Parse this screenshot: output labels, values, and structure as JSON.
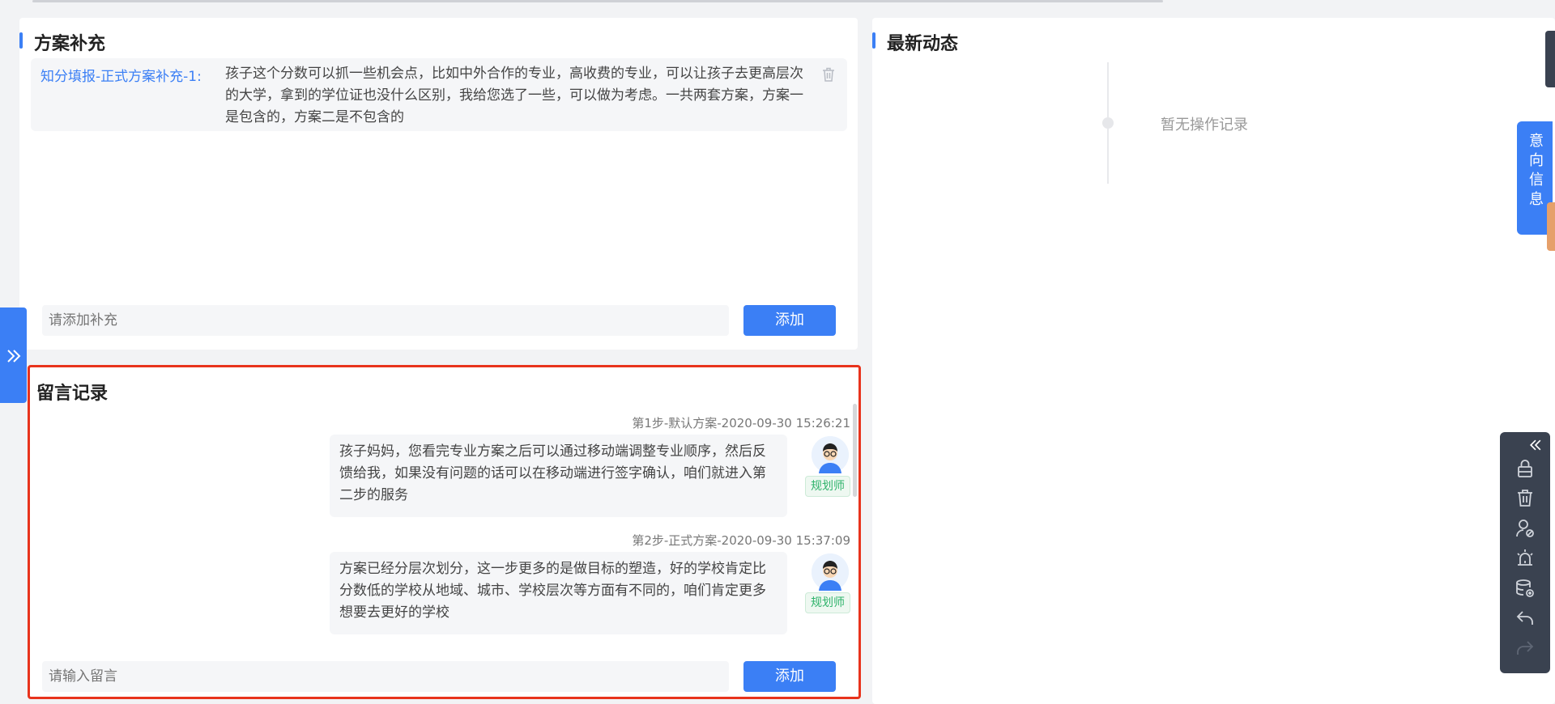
{
  "plan_supplement": {
    "title": "方案补充",
    "items": [
      {
        "label": "知分填报-正式方案补充-1:",
        "text": "孩子这个分数可以抓一些机会点，比如中外合作的专业，高收费的专业，可以让孩子去更高层次的大学，拿到的学位证也没什么区别，我给您选了一些，可以做为考虑。一共两套方案，方案一是包含的，方案二是不包含的"
      }
    ],
    "input_placeholder": "请添加补充",
    "add_label": "添加"
  },
  "news": {
    "title": "最新动态",
    "empty_text": "暂无操作记录"
  },
  "messages": {
    "title": "留言记录",
    "items": [
      {
        "time": "第1步-默认方案-2020-09-30 15:26:21",
        "text": "孩子妈妈，您看完专业方案之后可以通过移动端调整专业顺序，然后反馈给我，如果没有问题的话可以在移动端进行签字确认，咱们就进入第二步的服务",
        "role": "规划师"
      },
      {
        "time": "第2步-正式方案-2020-09-30 15:37:09",
        "text": "方案已经分层次划分，这一步更多的是做目标的塑造，好的学校肯定比分数低的学校从地域、城市、学校层次等方面有不同的，咱们肯定更多想要去更好的学校",
        "role": "规划师"
      }
    ],
    "input_placeholder": "请输入留言",
    "add_label": "添加"
  },
  "side": {
    "intent_tab": "意向信息",
    "collapse_icon": "double-chevron-right-icon"
  },
  "toolbar": {
    "icons": [
      "double-chevron-left-icon",
      "lock-icon",
      "trash-icon",
      "user-block-icon",
      "alarm-icon",
      "database-add-icon",
      "undo-icon",
      "redo-icon"
    ]
  },
  "colors": {
    "accent": "#3b7ff5",
    "highlight_border": "#e8331c",
    "role_green": "#2fb36b",
    "toolbar_bg": "#3a4250"
  }
}
